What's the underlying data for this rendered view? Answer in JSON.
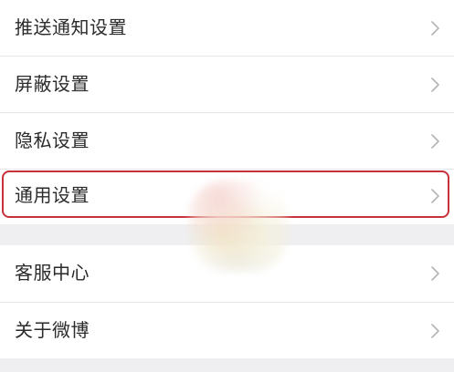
{
  "settings_list": {
    "group1": [
      {
        "label": "推送通知设置",
        "icon": "chevron-right-icon"
      },
      {
        "label": "屏蔽设置",
        "icon": "chevron-right-icon"
      },
      {
        "label": "隐私设置",
        "icon": "chevron-right-icon"
      },
      {
        "label": "通用设置",
        "icon": "chevron-right-icon",
        "highlighted": true
      }
    ],
    "group2": [
      {
        "label": "客服中心",
        "icon": "chevron-right-icon"
      },
      {
        "label": "关于微博",
        "icon": "chevron-right-icon"
      }
    ]
  },
  "colors": {
    "background": "#efeff1",
    "row_background": "#ffffff",
    "text": "#2b2b2b",
    "chevron": "#b5b5b5",
    "divider": "#e6e6e6",
    "highlight_border": "#c8303a"
  }
}
